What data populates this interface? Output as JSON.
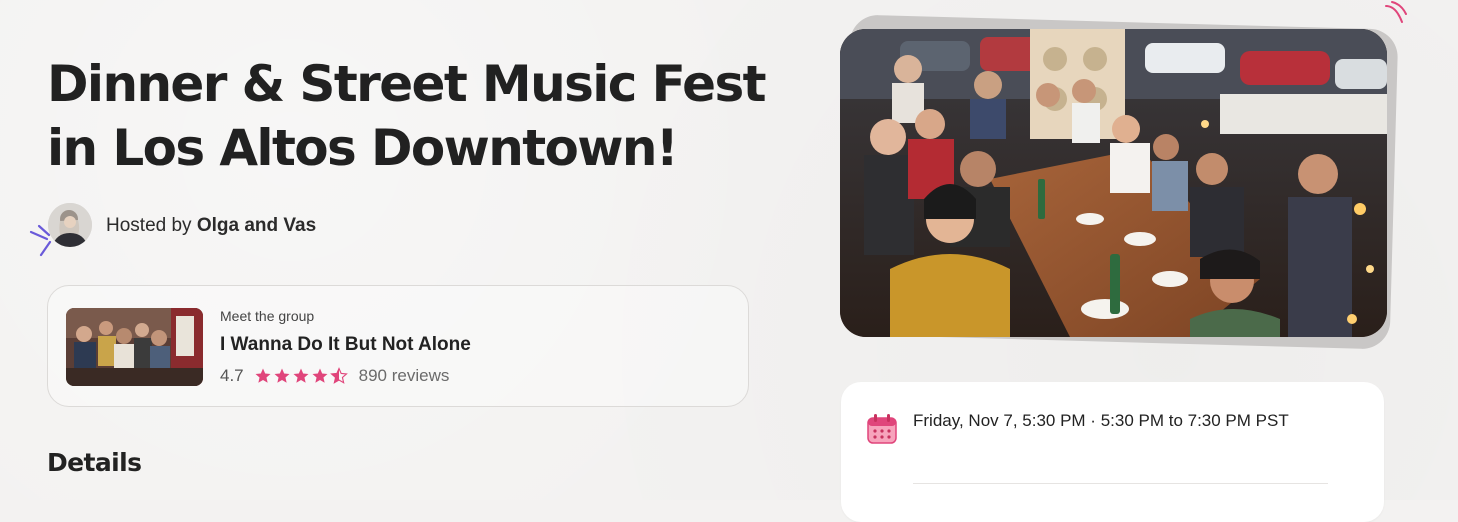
{
  "event": {
    "title": "Dinner & Street Music Fest in Los Altos Downtown!",
    "host_prefix": "Hosted by",
    "host_names": "Olga and Vas"
  },
  "group": {
    "label": "Meet the group",
    "name": "I Wanna Do It But Not Alone",
    "rating": "4.7",
    "rating_value": 4.7,
    "max_rating": 5,
    "reviews": "890 reviews"
  },
  "details": {
    "heading": "Details"
  },
  "datetime": {
    "text": "Friday, Nov 7, 5:30 PM · 5:30 PM to 7:30 PM PST"
  },
  "colors": {
    "star": "#e0457b",
    "accent_purple": "#6a5ad9",
    "accent_pink": "#e0457b",
    "calendar": "#f0769a"
  },
  "icons": {
    "calendar": "calendar-icon",
    "star": "star-icon"
  }
}
